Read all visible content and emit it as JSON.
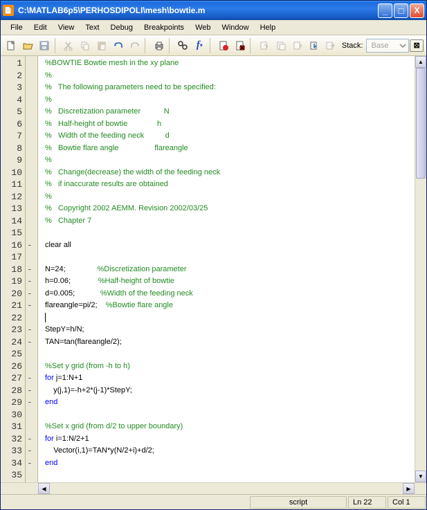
{
  "title": "C:\\MATLAB6p5\\PERHOSDIPOLI\\mesh\\bowtie.m",
  "menu": [
    "File",
    "Edit",
    "View",
    "Text",
    "Debug",
    "Breakpoints",
    "Web",
    "Window",
    "Help"
  ],
  "toolbar": {
    "stack_label": "Stack:",
    "stack_value": "Base"
  },
  "status": {
    "type": "script",
    "line": "Ln 22",
    "col": "Col 1"
  },
  "lines": [
    {
      "n": 1,
      "d": "",
      "c": "comment",
      "t": "%BOWTIE Bowtie mesh in the xy plane"
    },
    {
      "n": 2,
      "d": "",
      "c": "comment",
      "t": "%"
    },
    {
      "n": 3,
      "d": "",
      "c": "comment",
      "t": "%   The following parameters need to be specified:"
    },
    {
      "n": 4,
      "d": "",
      "c": "comment",
      "t": "%"
    },
    {
      "n": 5,
      "d": "",
      "c": "comment",
      "t": "%   Discretization parameter           N"
    },
    {
      "n": 6,
      "d": "",
      "c": "comment",
      "t": "%   Half-height of bowtie              h"
    },
    {
      "n": 7,
      "d": "",
      "c": "comment",
      "t": "%   Width of the feeding neck          d"
    },
    {
      "n": 8,
      "d": "",
      "c": "comment",
      "t": "%   Bowtie flare angle                 flareangle"
    },
    {
      "n": 9,
      "d": "",
      "c": "comment",
      "t": "%"
    },
    {
      "n": 10,
      "d": "",
      "c": "comment",
      "t": "%   Change(decrease) the width of the feeding neck"
    },
    {
      "n": 11,
      "d": "",
      "c": "comment",
      "t": "%   if inaccurate results are obtained"
    },
    {
      "n": 12,
      "d": "",
      "c": "comment",
      "t": "%"
    },
    {
      "n": 13,
      "d": "",
      "c": "comment",
      "t": "%   Copyright 2002 AEMM. Revision 2002/03/25 "
    },
    {
      "n": 14,
      "d": "",
      "c": "comment",
      "t": "%   Chapter 7"
    },
    {
      "n": 15,
      "d": "",
      "c": "",
      "t": ""
    },
    {
      "n": 16,
      "d": "-",
      "c": "",
      "t": "clear all"
    },
    {
      "n": 17,
      "d": "",
      "c": "",
      "t": ""
    },
    {
      "n": 18,
      "d": "-",
      "c": "mix",
      "t": "N=24;               ",
      "t2": "%Discretization parameter"
    },
    {
      "n": 19,
      "d": "-",
      "c": "mix",
      "t": "h=0.06;             ",
      "t2": "%Half-height of bowtie"
    },
    {
      "n": 20,
      "d": "-",
      "c": "mix",
      "t": "d=0.005;            ",
      "t2": "%Width of the feeding neck"
    },
    {
      "n": 21,
      "d": "-",
      "c": "mix",
      "t": "flareangle=pi/2;    ",
      "t2": "%Bowtie flare angle"
    },
    {
      "n": 22,
      "d": "",
      "c": "caret",
      "t": ""
    },
    {
      "n": 23,
      "d": "-",
      "c": "",
      "t": "StepY=h/N;"
    },
    {
      "n": 24,
      "d": "-",
      "c": "",
      "t": "TAN=tan(flareangle/2);"
    },
    {
      "n": 25,
      "d": "",
      "c": "",
      "t": ""
    },
    {
      "n": 26,
      "d": "",
      "c": "comment",
      "t": "%Set y grid (from -h to h)"
    },
    {
      "n": 27,
      "d": "-",
      "c": "key",
      "k": "for",
      "t": " j=1:N+1"
    },
    {
      "n": 28,
      "d": "-",
      "c": "",
      "t": "    y(j,1)=-h+2*(j-1)*StepY;"
    },
    {
      "n": 29,
      "d": "-",
      "c": "key",
      "k": "end",
      "t": ""
    },
    {
      "n": 30,
      "d": "",
      "c": "",
      "t": ""
    },
    {
      "n": 31,
      "d": "",
      "c": "comment",
      "t": "%Set x grid (from d/2 to upper boundary)"
    },
    {
      "n": 32,
      "d": "-",
      "c": "key",
      "k": "for",
      "t": " i=1:N/2+1"
    },
    {
      "n": 33,
      "d": "-",
      "c": "",
      "t": "    Vector(i,1)=TAN*y(N/2+i)+d/2;"
    },
    {
      "n": 34,
      "d": "-",
      "c": "key",
      "k": "end",
      "t": ""
    },
    {
      "n": 35,
      "d": "",
      "c": "",
      "t": ""
    }
  ]
}
